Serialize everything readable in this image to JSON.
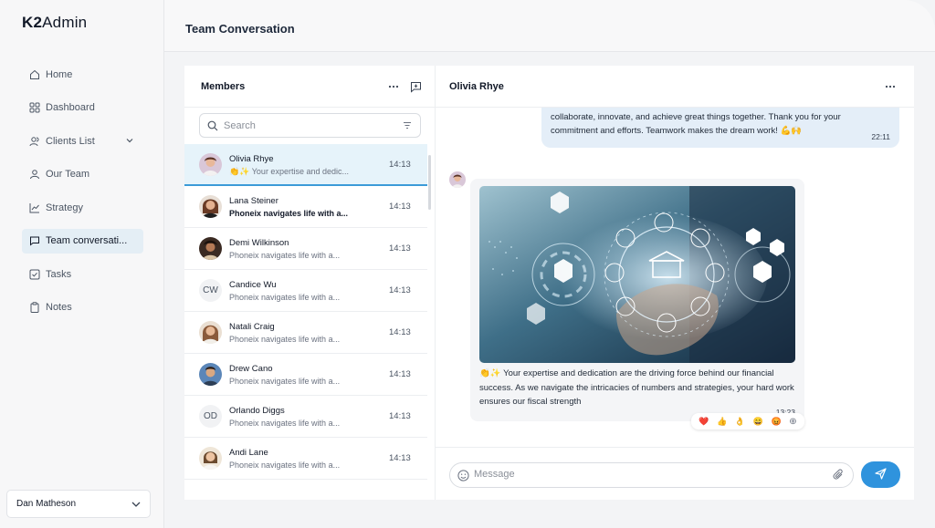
{
  "app": {
    "logo": "K2Admin"
  },
  "sidebar": {
    "items": [
      {
        "label": "Home",
        "icon": "home-icon"
      },
      {
        "label": "Dashboard",
        "icon": "dashboard-icon"
      },
      {
        "label": "Clients List",
        "icon": "users-icon"
      },
      {
        "label": "Our Team",
        "icon": "team-icon"
      },
      {
        "label": "Strategy",
        "icon": "chart-line-icon"
      },
      {
        "label": "Team conversati...",
        "icon": "chat-icon",
        "active": true
      },
      {
        "label": "Tasks",
        "icon": "checkbox-icon"
      },
      {
        "label": "Notes",
        "icon": "clipboard-icon"
      }
    ],
    "user": "Dan Matheson"
  },
  "header": {
    "title": "Team Conversation"
  },
  "members": {
    "title": "Members",
    "search_placeholder": "Search",
    "list": [
      {
        "name": "Olivia Rhye",
        "preview": "👏✨ Your expertise and dedic...",
        "time": "14:13",
        "active": true
      },
      {
        "name": "Lana Steiner",
        "preview": "Phoneix navigates life with a...",
        "time": "14:13",
        "unread": true
      },
      {
        "name": "Demi Wilkinson",
        "preview": "Phoneix navigates life with a...",
        "time": "14:13"
      },
      {
        "name": "Candice Wu",
        "preview": "Phoneix navigates life with a...",
        "time": "14:13",
        "initials": "CW"
      },
      {
        "name": "Natali Craig",
        "preview": "Phoneix navigates life with a...",
        "time": "14:13"
      },
      {
        "name": "Drew Cano",
        "preview": "Phoneix navigates life with a...",
        "time": "14:13"
      },
      {
        "name": "Orlando Diggs",
        "preview": "Phoneix navigates life with a...",
        "time": "14:13",
        "initials": "OD"
      },
      {
        "name": "Andi Lane",
        "preview": "Phoneix navigates life with a...",
        "time": "14:13"
      }
    ]
  },
  "chat": {
    "title": "Olivia Rhye",
    "outgoing": {
      "text": "collaborate, innovate, and achieve great things together. Thank you for your commitment and efforts. Teamwork makes the dream work! 💪🙌",
      "time": "22:11"
    },
    "incoming": {
      "text": "👏✨ Your expertise and dedication are the driving force behind our financial success. As we navigate the intricacies of numbers and strategies, your hard work ensures our fiscal strength",
      "time": "13:23"
    },
    "reactions": [
      "❤️",
      "👍",
      "👌",
      "😄",
      "😡",
      "⊕"
    ],
    "composer_placeholder": "Message"
  },
  "colors": {
    "accent": "#2f93dd",
    "active_bg": "#e6f3fa",
    "outgoing_bubble": "#e4eef8"
  }
}
